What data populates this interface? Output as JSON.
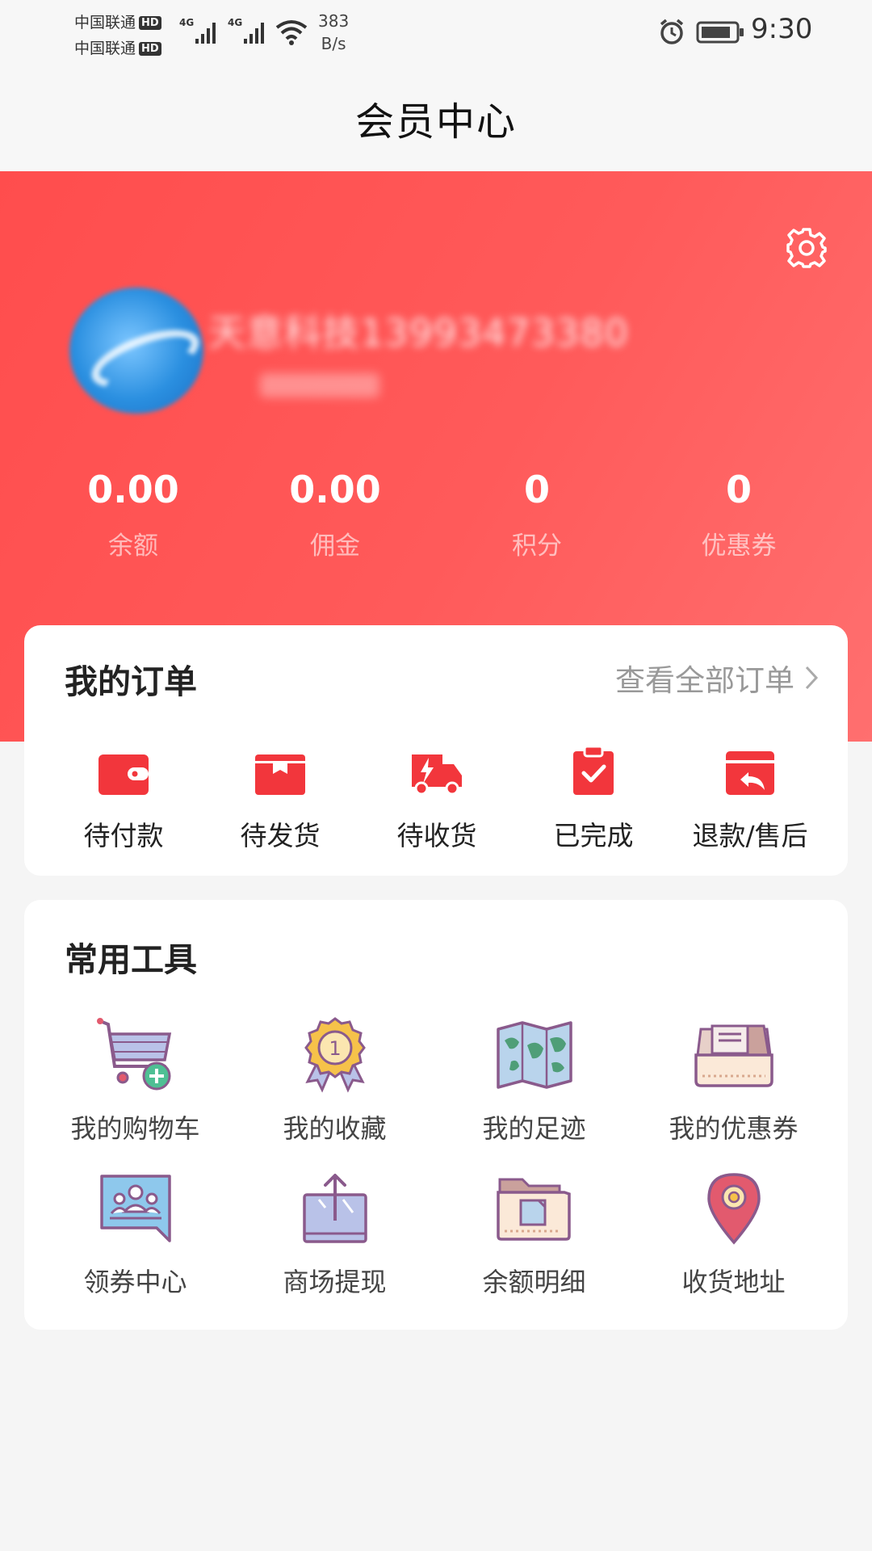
{
  "status_bar": {
    "carrier1": "中国联通",
    "carrier2": "中国联通",
    "hd": "HD",
    "net_speed_value": "383",
    "net_speed_unit": "B/s",
    "time": "9:30"
  },
  "header": {
    "title": "会员中心"
  },
  "profile": {
    "username": "天意科技13993473380"
  },
  "stats": [
    {
      "value": "0.00",
      "label": "余额"
    },
    {
      "value": "0.00",
      "label": "佣金"
    },
    {
      "value": "0",
      "label": "积分"
    },
    {
      "value": "0",
      "label": "优惠券"
    }
  ],
  "orders": {
    "title": "我的订单",
    "view_all": "查看全部订单",
    "items": [
      {
        "label": "待付款",
        "icon": "wallet-icon"
      },
      {
        "label": "待发货",
        "icon": "box-icon"
      },
      {
        "label": "待收货",
        "icon": "truck-icon"
      },
      {
        "label": "已完成",
        "icon": "clipboard-check-icon"
      },
      {
        "label": "退款/售后",
        "icon": "refund-icon"
      }
    ]
  },
  "tools": {
    "title": "常用工具",
    "items": [
      {
        "label": "我的购物车",
        "icon": "cart-icon"
      },
      {
        "label": "我的收藏",
        "icon": "medal-icon"
      },
      {
        "label": "我的足迹",
        "icon": "map-icon"
      },
      {
        "label": "我的优惠券",
        "icon": "coupon-box-icon"
      },
      {
        "label": "领券中心",
        "icon": "group-chat-icon"
      },
      {
        "label": "商场提现",
        "icon": "withdraw-icon"
      },
      {
        "label": "余额明细",
        "icon": "folder-icon"
      },
      {
        "label": "收货地址",
        "icon": "location-pin-icon"
      }
    ]
  },
  "colors": {
    "brand_red": "#ff4d4d",
    "order_icon_red": "#f2363c"
  }
}
